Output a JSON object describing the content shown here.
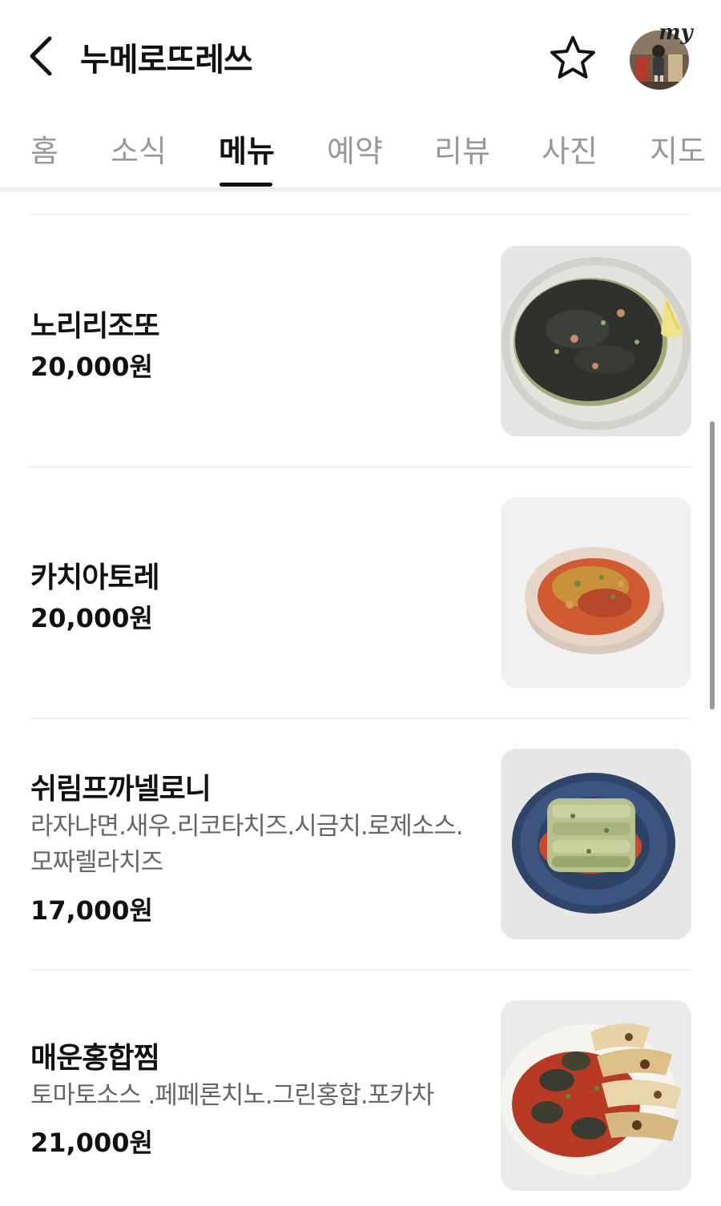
{
  "header": {
    "title": "누메로뜨레쓰",
    "back_icon": "chevron-left-icon",
    "favorite_icon": "star-icon",
    "avatar_badge": "my"
  },
  "tabs": [
    {
      "label": "홈"
    },
    {
      "label": "소식"
    },
    {
      "label": "메뉴",
      "active": true
    },
    {
      "label": "예약"
    },
    {
      "label": "리뷰"
    },
    {
      "label": "사진"
    },
    {
      "label": "지도"
    }
  ],
  "menu": {
    "items": [
      {
        "name": "노리리조또",
        "description": "",
        "price": "20,000원",
        "photo": "black squid-ink risotto with lemon wedge on white plate"
      },
      {
        "name": "카치아토레",
        "description": "",
        "price": "20,000원",
        "photo": "tomato stew with breadcrumbs in shallow bowl"
      },
      {
        "name": "쉬림프까넬로니",
        "description": "라자냐면.새우.리코타치즈.시금치.로제소스.모짜렐라치즈",
        "price": "17,000원",
        "photo": "baked cannelloni on blue ribbed plate"
      },
      {
        "name": "매운홍합찜",
        "description": "토마토소스 .페페론치노.그린홍합.포카차",
        "price": "21,000원",
        "photo": "spicy mussels in tomato sauce with focaccia"
      }
    ]
  },
  "colors": {
    "text": "#111111",
    "muted": "#999999",
    "description": "#666666",
    "divider": "#f0f0f0"
  }
}
